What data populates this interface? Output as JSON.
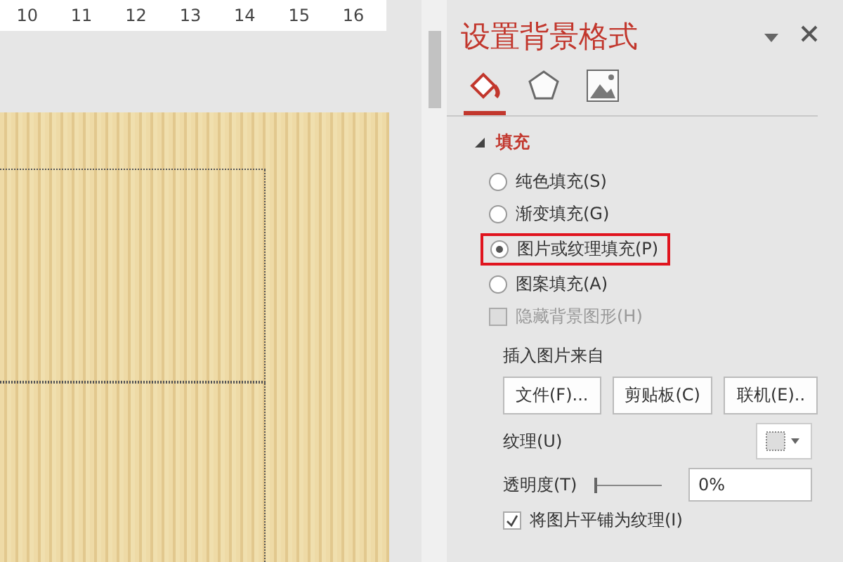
{
  "ruler": {
    "marks": [
      "10",
      "11",
      "12",
      "13",
      "14",
      "15",
      "16"
    ]
  },
  "panel": {
    "title": "设置背景格式",
    "tabs": [
      {
        "kind": "fill",
        "selected": true
      },
      {
        "kind": "effects",
        "selected": false
      },
      {
        "kind": "picture",
        "selected": false
      }
    ],
    "section": {
      "title": "填充",
      "expanded": true
    },
    "options": [
      {
        "label": "纯色填充(S)",
        "selected": false,
        "highlighted": false
      },
      {
        "label": "渐变填充(G)",
        "selected": false,
        "highlighted": false
      },
      {
        "label": "图片或纹理填充(P)",
        "selected": true,
        "highlighted": true
      },
      {
        "label": "图案填充(A)",
        "selected": false,
        "highlighted": false
      }
    ],
    "hide_graphics": {
      "label": "隐藏背景图形(H)",
      "checked": false,
      "disabled": true
    },
    "insert_label": "插入图片来自",
    "buttons": [
      "文件(F)...",
      "剪贴板(C)",
      "联机(E).."
    ],
    "texture_label": "纹理(U)",
    "transparency": {
      "label": "透明度(T)",
      "level": 0,
      "value": "0%"
    },
    "tile": {
      "label": "将图片平铺为纹理(I)",
      "checked": true
    }
  }
}
